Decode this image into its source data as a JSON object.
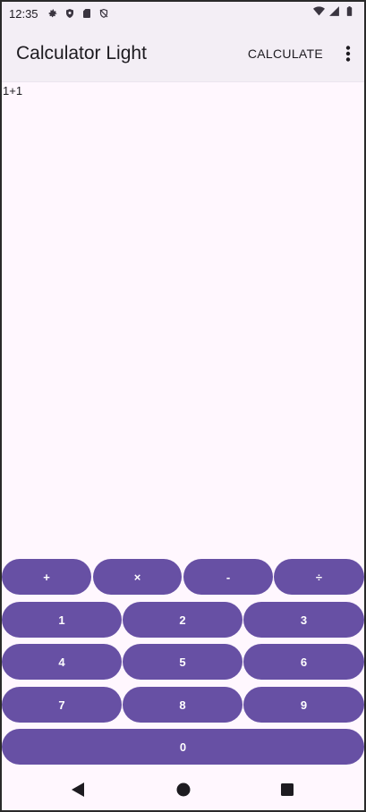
{
  "status_bar": {
    "time": "12:35",
    "icons_left": [
      "settings-icon",
      "shield-icon",
      "sim-card-icon",
      "vpn-shield-icon"
    ],
    "icons_right": [
      "wifi-icon",
      "cell-signal-icon",
      "battery-icon"
    ]
  },
  "app_bar": {
    "title": "Calculator Light",
    "action_label": "CALCULATE",
    "overflow_icon": "more-vert-icon"
  },
  "display": {
    "expression": "1+1"
  },
  "keypad": {
    "operators": [
      "+",
      "×",
      "-",
      "÷"
    ],
    "row1": [
      "1",
      "2",
      "3"
    ],
    "row2": [
      "4",
      "5",
      "6"
    ],
    "row3": [
      "7",
      "8",
      "9"
    ],
    "zero": "0"
  },
  "nav_bar": {
    "back": "back-icon",
    "home": "home-icon",
    "recents": "recents-icon"
  },
  "colors": {
    "key_background": "#6750a4",
    "app_bar_background": "#f3eef5",
    "screen_background": "#fff7fe"
  }
}
